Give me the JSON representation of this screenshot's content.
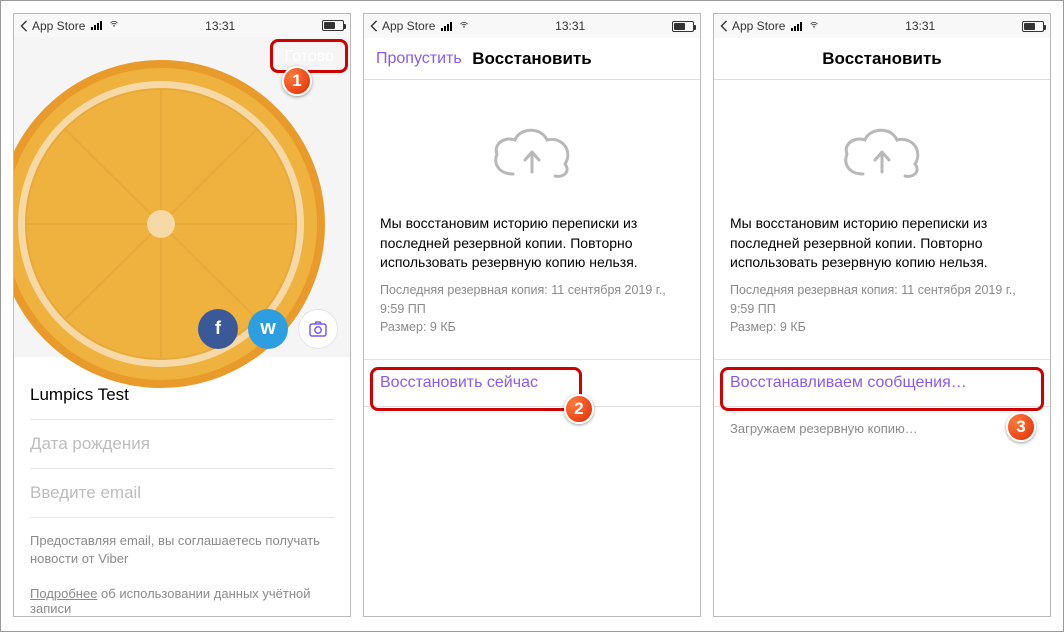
{
  "statusbar": {
    "back_label": "App Store",
    "time": "13:31"
  },
  "screen1": {
    "done_label": "Готово",
    "name_value": "Lumpics Test",
    "birthdate_placeholder": "Дата рождения",
    "email_placeholder": "Введите email",
    "disclaimer": "Предоставляя email, вы соглашаетесь получать новости от Viber",
    "more_underlined": "Подробнее",
    "more_rest": " об использовании данных учётной записи",
    "social": {
      "facebook_icon": "f",
      "vk_icon": "w",
      "camera_icon": "camera"
    }
  },
  "screen2": {
    "skip_label": "Пропустить",
    "title": "Восстановить",
    "description": "Мы восстановим историю переписки из последней резервной копии. Повторно использовать резервную копию нельзя.",
    "meta_line1": "Последняя резервная копия: 11 сентября 2019 г., 9:59 ПП",
    "meta_line2": "Размер: 9 КБ",
    "action_label": "Восстановить сейчас"
  },
  "screen3": {
    "title": "Восстановить",
    "description": "Мы восстановим историю переписки из последней резервной копии. Повторно использовать резервную копию нельзя.",
    "meta_line1": "Последняя резервная копия: 11 сентября 2019 г., 9:59 ПП",
    "meta_line2": "Размер: 9 КБ",
    "action_label": "Восстанавливаем сообщения…",
    "loading_text": "Загружаем резервную копию…"
  },
  "badges": {
    "one": "1",
    "two": "2",
    "three": "3"
  }
}
